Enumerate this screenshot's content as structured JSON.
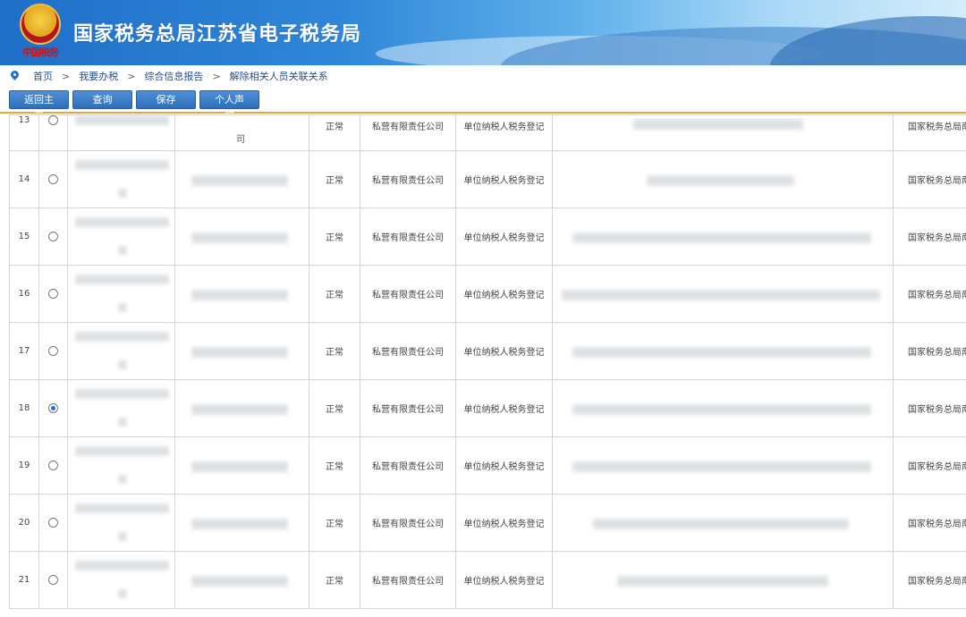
{
  "header": {
    "title": "国家税务总局江苏省电子税务局",
    "emblem_text": "中国税务"
  },
  "breadcrumb": {
    "items": [
      "首页",
      "我要办税",
      "综合信息报告",
      "解除相关人员关联关系"
    ],
    "separator": ">"
  },
  "toolbar": {
    "back_label": "返回主页",
    "query_label": "查询",
    "save_label": "保存",
    "statement_label": "个人声明"
  },
  "table": {
    "rows": [
      {
        "no": "13",
        "selected": false,
        "code_tail": "司",
        "status": "正常",
        "type": "私营有限责任公司",
        "reg": "单位纳税人税务登记",
        "auth": "国家税务总局南"
      },
      {
        "no": "14",
        "selected": false,
        "code_tail": "",
        "status": "正常",
        "type": "私营有限责任公司",
        "reg": "单位纳税人税务登记",
        "auth": "国家税务总局南"
      },
      {
        "no": "15",
        "selected": false,
        "code_tail": "",
        "status": "正常",
        "type": "私营有限责任公司",
        "reg": "单位纳税人税务登记",
        "auth": "国家税务总局南"
      },
      {
        "no": "16",
        "selected": false,
        "code_tail": "",
        "status": "正常",
        "type": "私营有限责任公司",
        "reg": "单位纳税人税务登记",
        "auth": "国家税务总局南"
      },
      {
        "no": "17",
        "selected": false,
        "code_tail": "",
        "status": "正常",
        "type": "私营有限责任公司",
        "reg": "单位纳税人税务登记",
        "auth": "国家税务总局南"
      },
      {
        "no": "18",
        "selected": true,
        "code_tail": "",
        "status": "正常",
        "type": "私营有限责任公司",
        "reg": "单位纳税人税务登记",
        "auth": "国家税务总局南"
      },
      {
        "no": "19",
        "selected": false,
        "code_tail": "",
        "status": "正常",
        "type": "私营有限责任公司",
        "reg": "单位纳税人税务登记",
        "auth": "国家税务总局南"
      },
      {
        "no": "20",
        "selected": false,
        "code_tail": "",
        "status": "正常",
        "type": "私营有限责任公司",
        "reg": "单位纳税人税务登记",
        "auth": "国家税务总局南"
      },
      {
        "no": "21",
        "selected": false,
        "code_tail": "",
        "status": "正常",
        "type": "私营有限责任公司",
        "reg": "单位纳税人税务登记",
        "auth": "国家税务总局南"
      }
    ]
  },
  "colors": {
    "banner": "#2f86d8",
    "accent_line": "#e0a93a",
    "button": "#3a7cc8",
    "link": "#2b4f86"
  }
}
